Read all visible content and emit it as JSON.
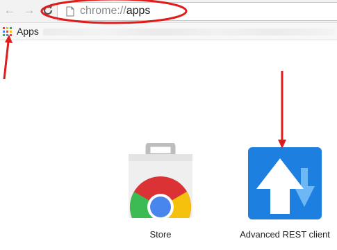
{
  "browser": {
    "url_scheme": "chrome://",
    "url_path": "apps",
    "back_icon": "back-arrow-icon",
    "forward_icon": "forward-arrow-icon",
    "reload_icon": "reload-icon",
    "page_icon": "page-icon"
  },
  "bookmarks_bar": {
    "apps_label": "Apps",
    "apps_icon": "apps-grid-icon",
    "apps_grid_colors": [
      "#e94235",
      "#fbbc05",
      "#34a853",
      "#4285f4",
      "#e94235",
      "#fbbc05",
      "#34a853",
      "#4285f4",
      "#e94235"
    ]
  },
  "apps": [
    {
      "label": "Store",
      "icon": "chrome-web-store-icon"
    },
    {
      "label": "Advanced REST client",
      "icon": "advanced-rest-client-icon"
    }
  ],
  "annotations": {
    "color": "#e01b1b",
    "items": [
      "ellipse-around-url",
      "arrow-to-apps-link",
      "arrow-to-rest-client"
    ]
  }
}
